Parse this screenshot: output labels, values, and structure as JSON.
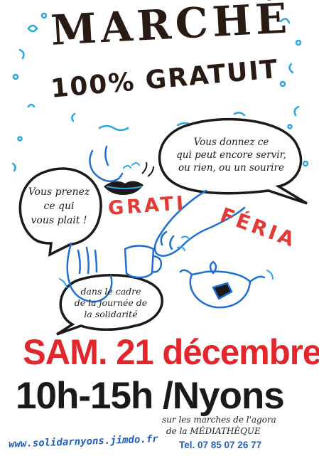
{
  "poster": {
    "title": "MARCHÉ",
    "subtitle": "100% GRATUIT",
    "bubble_right": [
      "Vous donnez ce",
      "qui peut encore servir,",
      "ou rien, ou un sourire"
    ],
    "bubble_left": [
      "Vous prenez",
      "ce qui",
      "vous plait !"
    ],
    "bubble_center": [
      "dans le cadre",
      "de la journée de",
      "la solidarité"
    ],
    "graphic_word_1": "GRATI",
    "graphic_word_2": "FÉRIA",
    "date": "SAM. 21 décembre",
    "time_place": "10h-15h /Nyons",
    "venue_line1": "sur les marches de l'agora",
    "venue_line2": "de la MÉDIATHÈQUE",
    "website": "www.solidarnyons.jimdo.fr",
    "phone": "Tel. 07 85 07 26 77"
  },
  "colors": {
    "ink": "#2a1a14",
    "accent_blue": "#2aa6e0",
    "accent_red": "#e3262b",
    "link_blue": "#1f5fbf",
    "speech_bubble_fill": "#ffffff"
  },
  "illustrations": [
    "water-drop-icon",
    "lips-icon",
    "giving-hand-icon",
    "receiving-hand-icon",
    "mug-icon",
    "teapot-icon"
  ]
}
